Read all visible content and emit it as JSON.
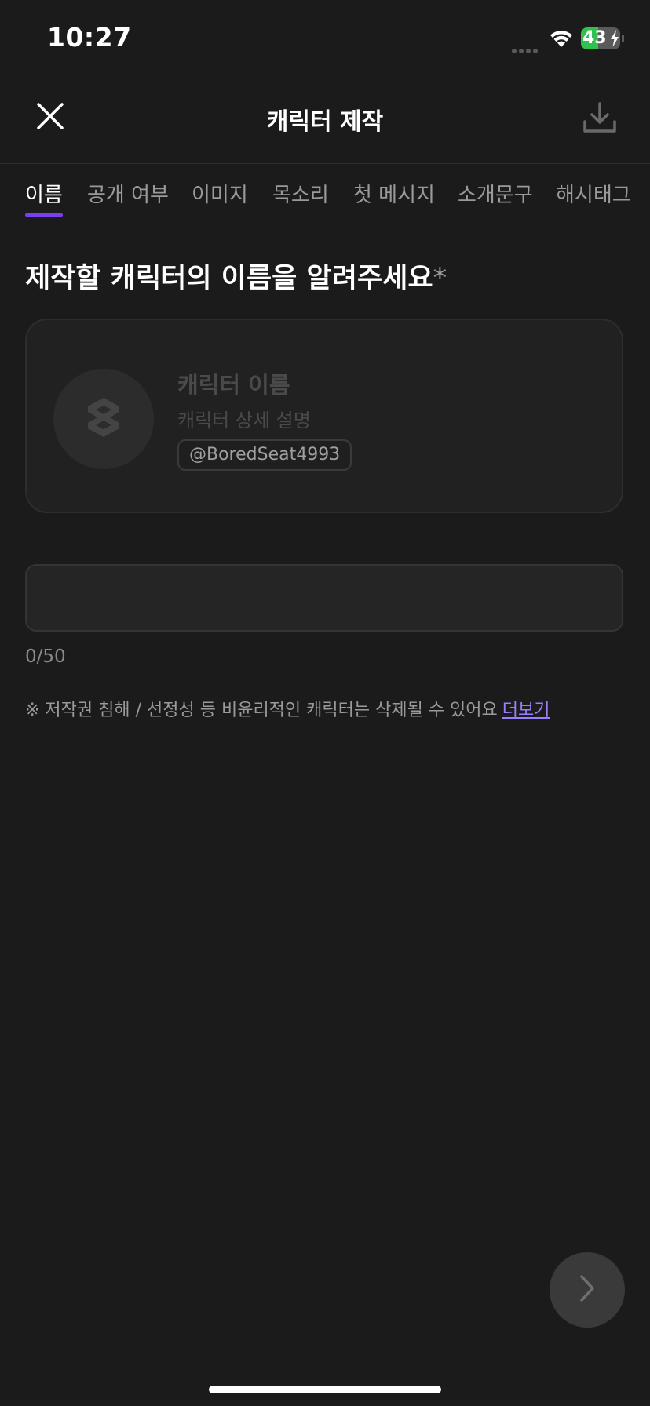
{
  "status_bar": {
    "time": "10:27",
    "battery_level": 43,
    "battery_label": "43",
    "signal_icon": "signal-dots-icon",
    "wifi_icon": "wifi-icon",
    "charging_icon": "bolt-icon"
  },
  "header": {
    "title": "캐릭터 제작",
    "close_icon": "close-icon",
    "download_icon": "download-icon"
  },
  "tabs": [
    {
      "label": "이름",
      "active": true
    },
    {
      "label": "공개 여부",
      "active": false
    },
    {
      "label": "이미지",
      "active": false
    },
    {
      "label": "목소리",
      "active": false
    },
    {
      "label": "첫 메시지",
      "active": false
    },
    {
      "label": "소개문구",
      "active": false
    },
    {
      "label": "해시태그",
      "active": false
    }
  ],
  "heading": {
    "text": "제작할 캐릭터의 이름을 알려주세요",
    "required_mark": "*"
  },
  "preview": {
    "name": "캐릭터 이름",
    "description": "캐릭터 상세 설명",
    "handle": "@BoredSeat4993",
    "avatar_icon": "logo-placeholder-icon"
  },
  "name_input": {
    "value": "",
    "placeholder": ""
  },
  "char_count": "0/50",
  "notice": {
    "text": "※ 저작권 침해 / 선정성 등 비윤리적인 캐릭터는 삭제될 수 있어요",
    "link": "더보기"
  },
  "next_button": {
    "icon": "chevron-right-icon"
  },
  "colors": {
    "background": "#1b1b1b",
    "accent": "#7b3ff2",
    "link": "#9b7dff",
    "battery": "#30c14f"
  }
}
